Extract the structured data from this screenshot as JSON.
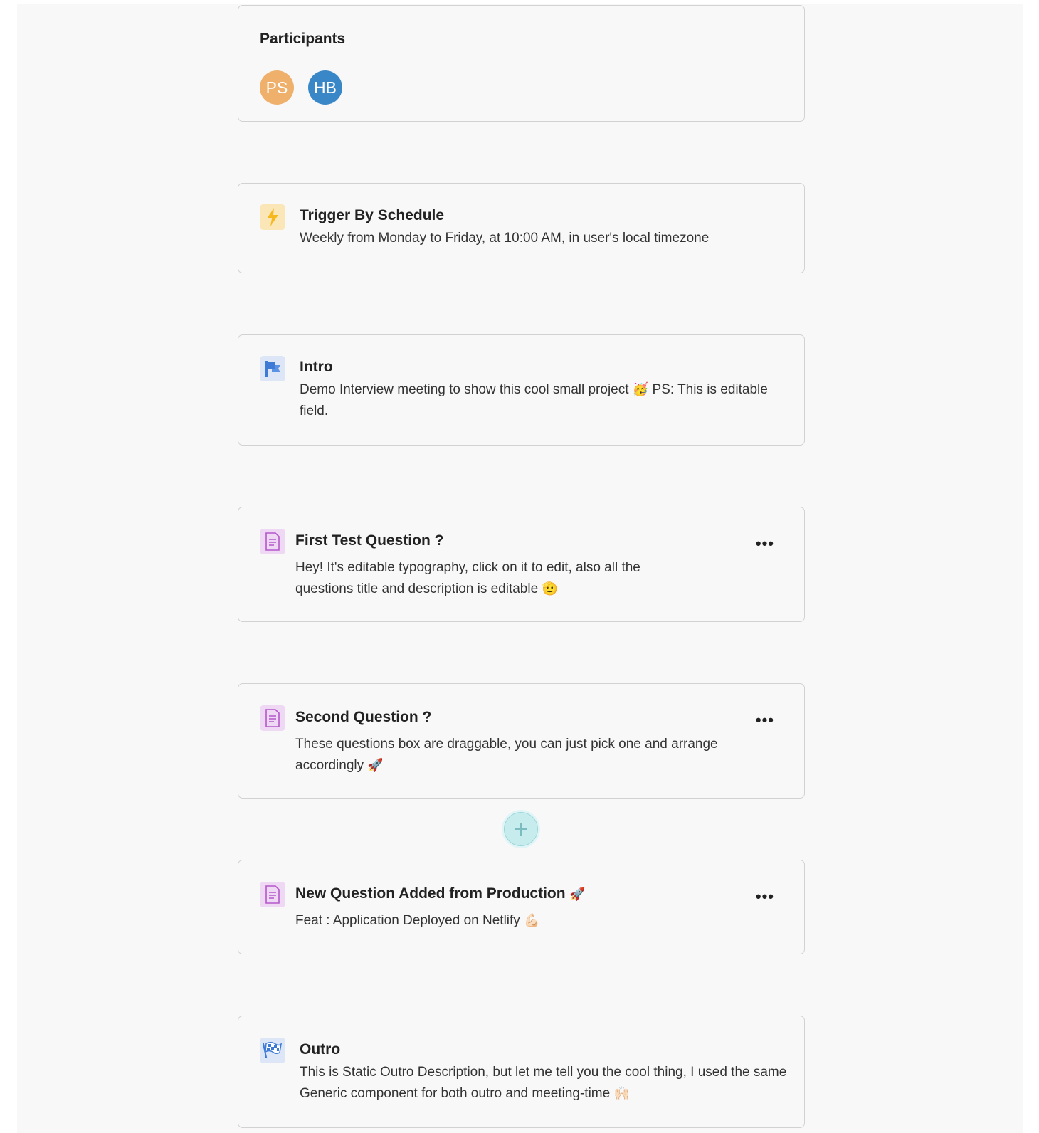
{
  "participants": {
    "title": "Participants",
    "avatars": [
      {
        "initials": "PS",
        "color": "#eeb06a"
      },
      {
        "initials": "HB",
        "color": "#3a87c8"
      }
    ]
  },
  "trigger": {
    "icon": "lightning-icon",
    "title": "Trigger By Schedule",
    "description": "Weekly from Monday to Friday, at 10:00 AM, in user's local timezone"
  },
  "intro": {
    "icon": "flag-icon",
    "title": "Intro",
    "description": "Demo Interview meeting to show this cool small project",
    "emoji": "🥳",
    "description_tail": "PS: This is editable field."
  },
  "questions": [
    {
      "icon": "document-icon",
      "title": "First Test Question ?",
      "description": "Hey! It's editable typography, click on it to edit, also all the questions title and description is editable",
      "emoji": "🫡",
      "more_label": "•••"
    },
    {
      "icon": "document-icon",
      "title": "Second Question ?",
      "description": "These questions box are draggable, you can just pick one and arrange accordingly",
      "emoji": "🚀",
      "more_label": "•••"
    },
    {
      "icon": "document-icon",
      "title": "New Question Added from Production",
      "title_emoji": "🚀",
      "description": "Feat : Application Deployed on Netlify",
      "emoji": "💪🏻",
      "more_label": "•••"
    }
  ],
  "add_button": {
    "icon": "plus-icon"
  },
  "outro": {
    "icon": "checkered-flag-icon",
    "title": "Outro",
    "description": "This is Static Outro Description, but let me tell you the cool thing, I used the same Generic component for both outro and meeting-time",
    "emoji": "🙌🏻"
  },
  "colors": {
    "trigger_tile": "#fbe6b8",
    "intro_tile": "#dde6f6",
    "question_tile": "#efd8f3",
    "add_button": "#c6ecee"
  }
}
